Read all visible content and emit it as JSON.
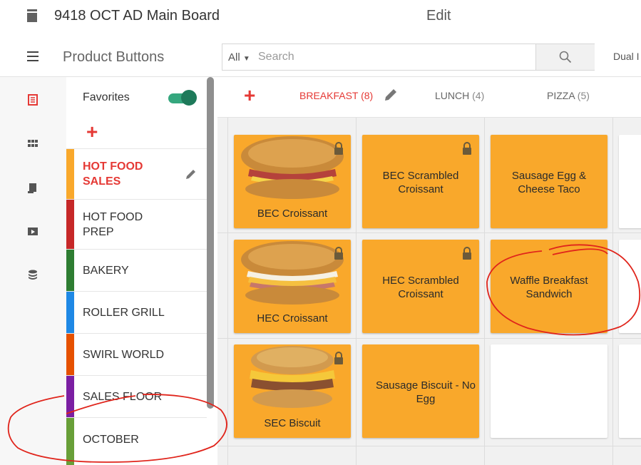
{
  "app": {
    "board_title": "9418 OCT AD Main Board",
    "mode_label": "Edit"
  },
  "header": {
    "title": "Product Buttons",
    "search_scope": "All",
    "search_placeholder": "Search",
    "search_value": "",
    "right_label": "Dual I"
  },
  "rail": {
    "icons": [
      "product-list-icon",
      "grid-icon",
      "receipt-icon",
      "media-icon",
      "database-icon"
    ],
    "active_color": "#e53935",
    "inactive_color": "#555555"
  },
  "categories": {
    "favorites_label": "Favorites",
    "favorites_on": true,
    "add_symbol": "+",
    "items": [
      {
        "label": "HOT FOOD SALES",
        "color": "#f9a82b",
        "active": true
      },
      {
        "label": "HOT FOOD PREP",
        "color": "#c62828",
        "active": false
      },
      {
        "label": "BAKERY",
        "color": "#2e7d32",
        "active": false
      },
      {
        "label": "ROLLER GRILL",
        "color": "#1e88e5",
        "active": false
      },
      {
        "label": "SWIRL WORLD",
        "color": "#e65100",
        "active": false
      },
      {
        "label": "SALES FLOOR",
        "color": "#7b1fa2",
        "active": false
      },
      {
        "label": "OCTOBER",
        "color": "#689f38",
        "active": false
      }
    ]
  },
  "tabs": {
    "add_symbol": "+",
    "items": [
      {
        "label": "BREAKFAST",
        "count": "(8)",
        "active": true
      },
      {
        "label": "LUNCH",
        "count": "(4)",
        "active": false
      },
      {
        "label": "PIZZA",
        "count": "(5)",
        "active": false
      }
    ]
  },
  "products": {
    "tile_color": "#f9a82b",
    "rows": [
      [
        {
          "label": "BEC Croissant",
          "image": "croissant-sandwich",
          "locked": true
        },
        {
          "label": "BEC Scrambled Croissant",
          "image": null,
          "locked": true
        },
        {
          "label": "Sausage Egg & Cheese Taco",
          "image": null,
          "locked": false
        }
      ],
      [
        {
          "label": "HEC Croissant",
          "image": "croissant-sandwich",
          "locked": true
        },
        {
          "label": "HEC Scrambled Croissant",
          "image": null,
          "locked": true
        },
        {
          "label": "Waffle Breakfast Sandwich",
          "image": null,
          "locked": false
        }
      ],
      [
        {
          "label": "SEC Biscuit",
          "image": "biscuit-sandwich",
          "locked": true
        },
        {
          "label": "Sausage Biscuit - No Egg",
          "image": null,
          "locked": false
        },
        {
          "label": "",
          "image": null,
          "locked": false,
          "empty": true
        }
      ]
    ]
  },
  "annotation": {
    "color": "#e0241b",
    "circled_items": [
      "Waffle Breakfast Sandwich",
      "OCTOBER"
    ]
  }
}
